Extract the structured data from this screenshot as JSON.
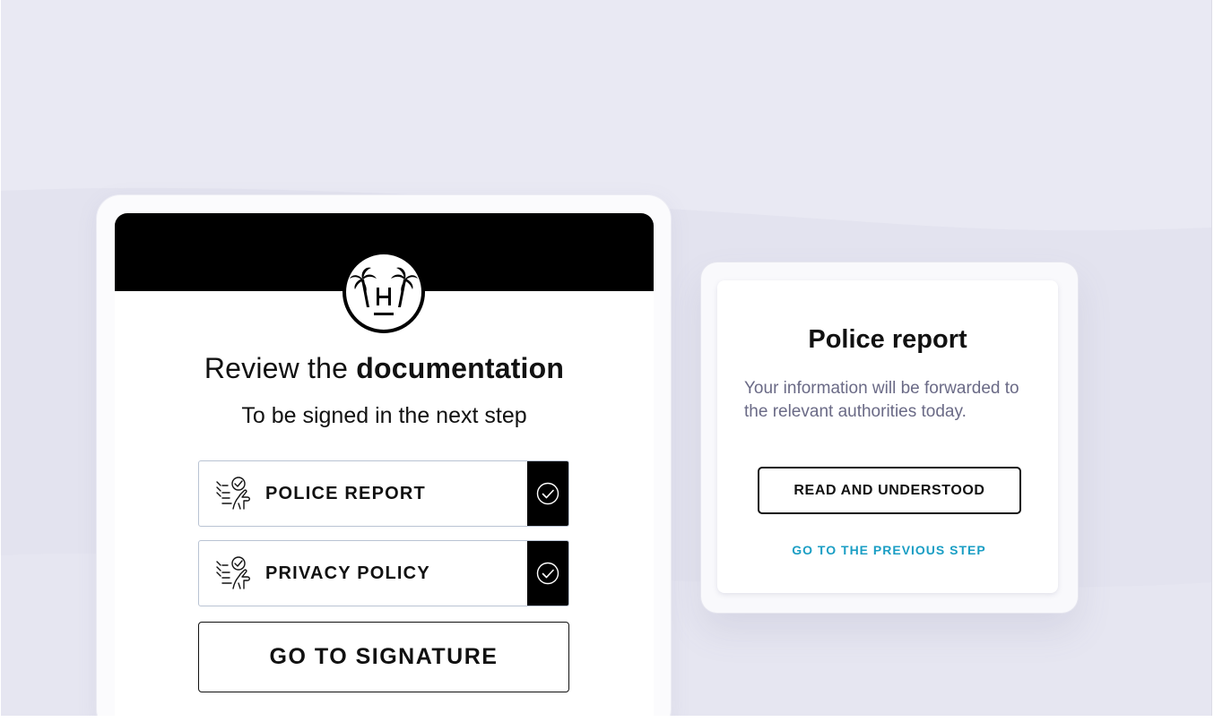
{
  "review": {
    "title_prefix": "Review the",
    "title_bold": "documentation",
    "subtitle": "To be signed in the next step"
  },
  "documents": [
    {
      "label": "POLICE REPORT",
      "icon": "sign-document-icon",
      "status_icon": "check-circle-icon"
    },
    {
      "label": "PRIVACY POLICY",
      "icon": "sign-document-icon",
      "status_icon": "check-circle-icon"
    }
  ],
  "signature_button": "GO TO SIGNATURE",
  "logo_icon": "palm-trees-logo",
  "modal": {
    "title": "Police report",
    "text": "Your information will be forwarded to the relevant authorities today.",
    "primary_button": "READ AND UNDERSTOOD",
    "link": "GO TO THE PREVIOUS STEP"
  },
  "colors": {
    "background": "#e9e9f3",
    "header": "#000000",
    "link": "#1a9ec4",
    "muted_text": "#6a6a86",
    "row_border": "#b9c3d3"
  }
}
